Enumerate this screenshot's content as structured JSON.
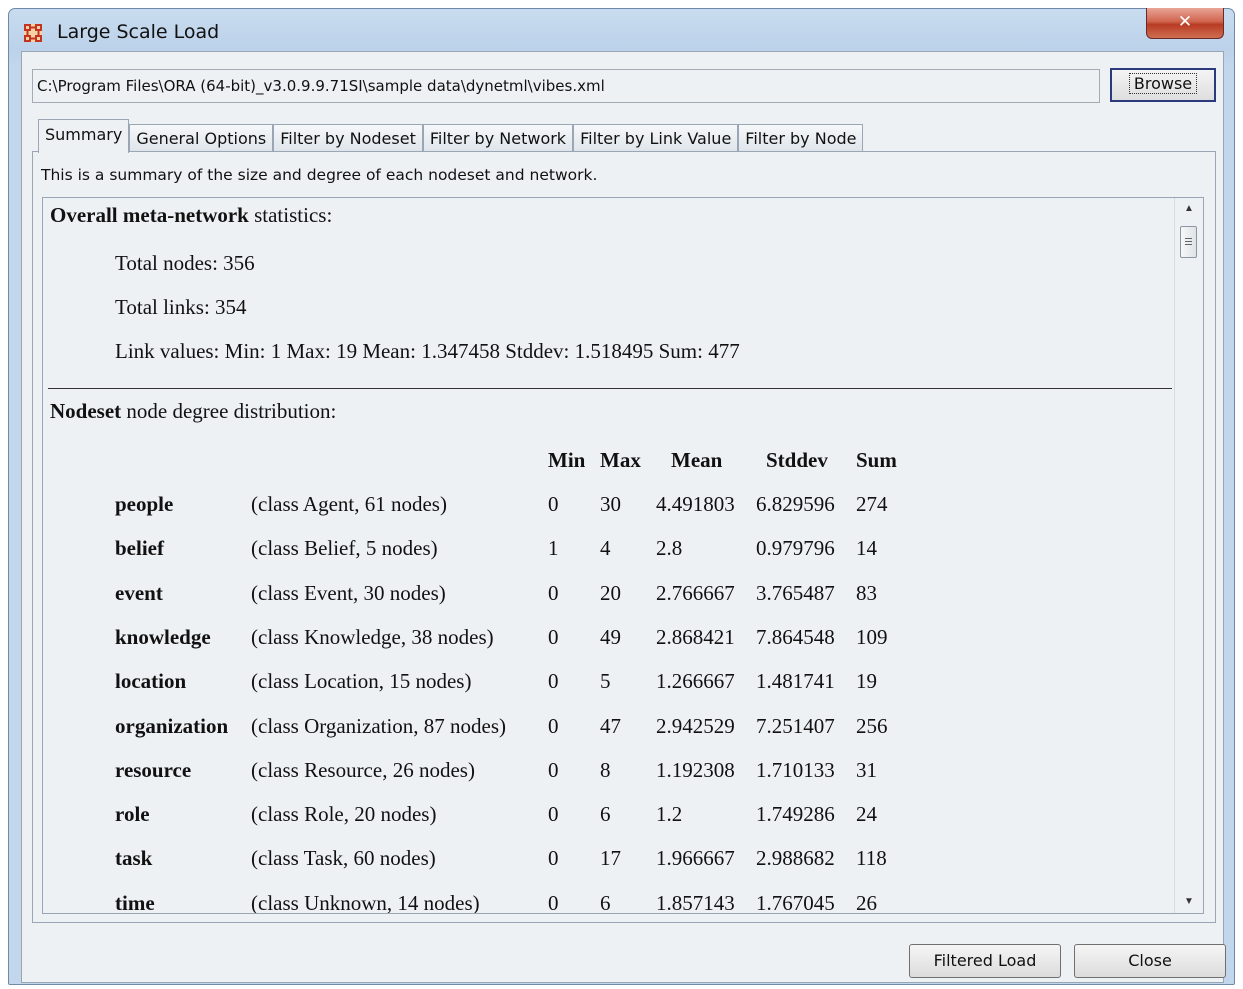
{
  "window": {
    "title": "Large Scale Load",
    "close_glyph": "✕"
  },
  "file": {
    "path": "C:\\Program Files\\ORA (64-bit)_v3.0.9.9.71SI\\sample data\\dynetml\\vibes.xml",
    "browse_label": "Browse"
  },
  "tabs": [
    {
      "label": "Summary",
      "active": true
    },
    {
      "label": "General Options",
      "active": false
    },
    {
      "label": "Filter by Nodeset",
      "active": false
    },
    {
      "label": "Filter by Network",
      "active": false
    },
    {
      "label": "Filter by Link Value",
      "active": false
    },
    {
      "label": "Filter by Node",
      "active": false
    }
  ],
  "summary": {
    "description": "This is a summary of the size and degree of each nodeset and network.",
    "overall_bold": "Overall meta-network",
    "overall_rest": " statistics:",
    "total_nodes": "Total nodes:  356",
    "total_links": "Total links:   354",
    "link_values": "Link values:  Min:  1  Max:  19  Mean:  1.347458  Stddev:  1.518495  Sum:  477",
    "nodeset_bold": "Nodeset",
    "nodeset_rest": " node degree distribution:",
    "headers": {
      "min": "Min",
      "max": "Max",
      "mean": "Mean",
      "stddev": "Stddev",
      "sum": "Sum"
    },
    "rows": [
      {
        "name": "people",
        "cls": "(class Agent, 61 nodes)",
        "min": "0",
        "max": "30",
        "mean": "4.491803",
        "stddev": "6.829596",
        "sum": "274"
      },
      {
        "name": "belief",
        "cls": "(class Belief, 5 nodes)",
        "min": "1",
        "max": "4",
        "mean": "2.8",
        "stddev": "0.979796",
        "sum": "14"
      },
      {
        "name": "event",
        "cls": "(class Event, 30 nodes)",
        "min": "0",
        "max": "20",
        "mean": "2.766667",
        "stddev": "3.765487",
        "sum": "83"
      },
      {
        "name": "knowledge",
        "cls": "(class Knowledge, 38 nodes)",
        "min": "0",
        "max": "49",
        "mean": "2.868421",
        "stddev": "7.864548",
        "sum": "109"
      },
      {
        "name": "location",
        "cls": "(class Location, 15 nodes)",
        "min": "0",
        "max": "5",
        "mean": "1.266667",
        "stddev": "1.481741",
        "sum": "19"
      },
      {
        "name": "organization",
        "cls": "(class Organization, 87 nodes)",
        "min": "0",
        "max": "47",
        "mean": "2.942529",
        "stddev": "7.251407",
        "sum": "256"
      },
      {
        "name": "resource",
        "cls": "(class Resource, 26 nodes)",
        "min": "0",
        "max": "8",
        "mean": "1.192308",
        "stddev": "1.710133",
        "sum": "31"
      },
      {
        "name": "role",
        "cls": "(class Role, 20 nodes)",
        "min": "0",
        "max": "6",
        "mean": "1.2",
        "stddev": "1.749286",
        "sum": "24"
      },
      {
        "name": "task",
        "cls": "(class Task, 60 nodes)",
        "min": "0",
        "max": "17",
        "mean": "1.966667",
        "stddev": "2.988682",
        "sum": "118"
      },
      {
        "name": "time",
        "cls": "(class Unknown, 14 nodes)",
        "min": "0",
        "max": "6",
        "mean": "1.857143",
        "stddev": "1.767045",
        "sum": "26"
      }
    ]
  },
  "footer": {
    "filtered_load_label": "Filtered Load",
    "close_label": "Close"
  }
}
